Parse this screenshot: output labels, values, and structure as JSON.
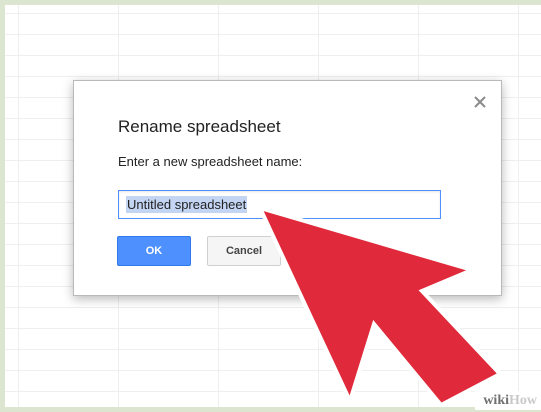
{
  "dialog": {
    "title": "Rename spreadsheet",
    "prompt": "Enter a new spreadsheet name:",
    "input_value": "Untitled spreadsheet",
    "ok_label": "OK",
    "cancel_label": "Cancel",
    "close_icon": "close-icon"
  },
  "watermark": {
    "part1": "wiki",
    "part2": "How"
  },
  "colors": {
    "ok_button": "#4d90fe",
    "arrow": "#e0293a",
    "selection": "#c3d5f2",
    "frame": "#c9d7b5"
  }
}
